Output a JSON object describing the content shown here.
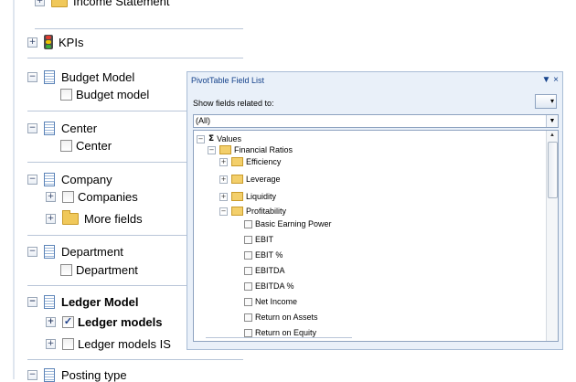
{
  "left_tree": {
    "items": [
      {
        "label": "Income Statement"
      },
      {
        "label": "KPIs"
      },
      {
        "label": "Budget Model",
        "child": "Budget model"
      },
      {
        "label": "Center",
        "child": "Center"
      },
      {
        "label": "Company",
        "children": [
          "Companies",
          "More fields"
        ]
      },
      {
        "label": "Department",
        "child": "Department"
      },
      {
        "label": "Ledger Model",
        "children": [
          "Ledger models",
          "Ledger models IS"
        ]
      },
      {
        "label": "Posting type"
      }
    ]
  },
  "pivot": {
    "title": "PivotTable Field List",
    "close_glyph": "▼ ×",
    "show_label": "Show fields related to:",
    "combo_value": "(All)",
    "tree": {
      "values": "Values",
      "financial_ratios": "Financial Ratios",
      "efficiency": "Efficiency",
      "leverage": "Leverage",
      "liquidity": "Liquidity",
      "profitability": "Profitability",
      "measures": [
        "Basic Earning Power",
        "EBIT",
        "EBIT %",
        "EBITDA",
        "EBITDA %",
        "Net Income",
        "Return on Assets",
        "Return on Equity"
      ]
    }
  },
  "colors": {
    "accent": "#15428b",
    "panel_bg": "#e9f0f9"
  }
}
